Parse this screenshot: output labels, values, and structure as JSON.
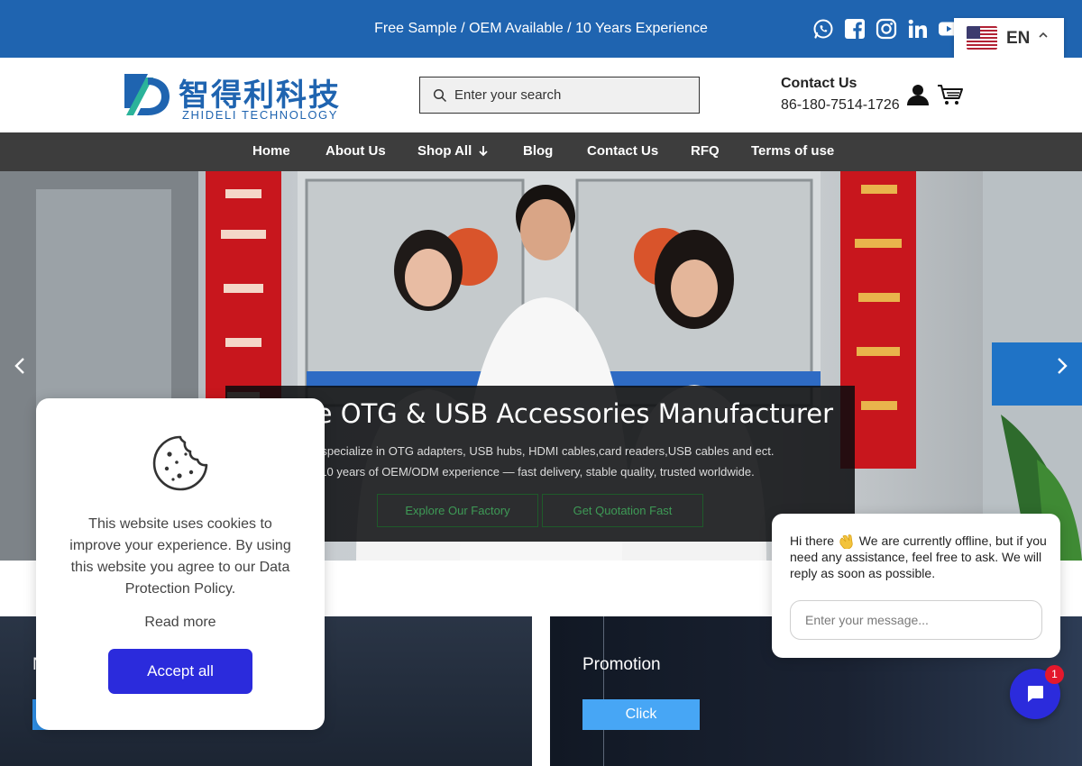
{
  "topbar": {
    "announcement": "Free Sample / OEM Available / 10 Years Experience",
    "social_icons": [
      "whatsapp-icon",
      "facebook-icon",
      "instagram-icon",
      "linkedin-icon",
      "youtube-icon"
    ],
    "background": "#1f64b0"
  },
  "language": {
    "label": "EN",
    "flag": "us-flag-icon"
  },
  "header": {
    "logo_cn": "智得利科技",
    "logo_en": "ZHIDELI TECHNOLOGY",
    "search_placeholder": "Enter your search",
    "contact_label": "Contact Us",
    "contact_phone": "86-180-7514-1726"
  },
  "nav": {
    "items": [
      {
        "label": "Home"
      },
      {
        "label": "About Us"
      },
      {
        "label": "Shop All"
      },
      {
        "label": "Blog"
      },
      {
        "label": "Contact Us"
      },
      {
        "label": "RFQ"
      },
      {
        "label": "Terms of use"
      }
    ],
    "background": "#3d3d3d"
  },
  "hero": {
    "title": "eliable OTG & USB Accessories Manufacturer",
    "line1": "We specialize in OTG adapters, USB hubs, HDMI cables,card readers,USB cables and ect.",
    "line2": "10 years of OEM/ODM experience — fast delivery, stable quality, trusted worldwide.",
    "button_factory": "Explore Our Factory",
    "button_quote": "Get Quotation Fast"
  },
  "promo": {
    "left_title_partial": "N",
    "right_title": "Promotion",
    "right_button": "Click"
  },
  "cookie": {
    "text": "This website uses cookies to improve your experience. By using this website you agree to our Data Protection Policy.",
    "read_more": "Read more",
    "accept": "Accept all",
    "accent": "#2b2bdc"
  },
  "chat": {
    "message_pre": "Hi there ",
    "message_post": " We are currently offline, but if you need any assistance, feel free to ask. We will reply as soon as possible.",
    "input_placeholder": "Enter your message...",
    "badge": "1"
  }
}
